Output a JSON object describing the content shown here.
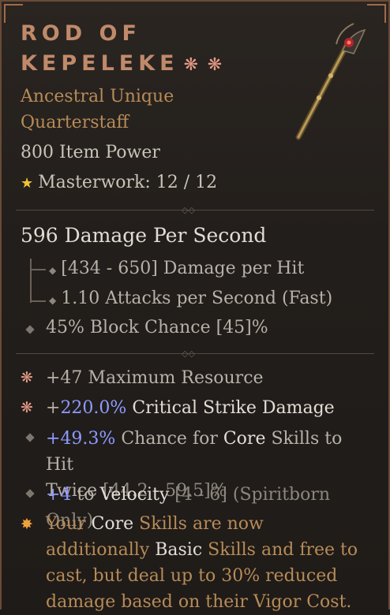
{
  "item": {
    "name_line1": "ROD OF",
    "name_line2": "KEPELEKE",
    "greater_affix_marks": "❋ ❋",
    "rarity": "Ancestral Unique",
    "type": "Quarterstaff",
    "item_power": "800 Item Power",
    "masterwork": "Masterwork: 12 / 12"
  },
  "weapon_stats": {
    "dps": "596 Damage Per Second",
    "damage_per_hit": "[434 - 650] Damage per Hit",
    "attack_speed": "1.10 Attacks per Second (Fast)",
    "block": "45% Block Chance [45]%"
  },
  "affixes": [
    {
      "prefix": "+47 Maximum Resource",
      "num": "",
      "text": "",
      "range": ""
    },
    {
      "prefix": "+",
      "num": "220.0%",
      "text": " Critical Strike Damage",
      "range": ""
    },
    {
      "prefix": "+",
      "num": "49.3%",
      "text": " Chance for ",
      "hl": "Core",
      "text2": " Skills to Hit",
      "text3": "Twice",
      "range": " [44.2 - 59.5]%"
    },
    {
      "prefix": "+",
      "num": "4",
      "text": " to ",
      "hl": "Velocity",
      "range": " [4 - 6] (Spiritborn Only)"
    }
  ],
  "unique_power": {
    "p1": "Your ",
    "hl1": "Core",
    "p2": " Skills are now additionally ",
    "hl2": "Basic",
    "p3": " Skills and free to cast, but deal up to 30% reduced damage based on their Vigor Cost."
  },
  "colors": {
    "legendary_orange": "#b78b58",
    "number_blue": "#8e9bff",
    "title": "#c08a6a"
  }
}
